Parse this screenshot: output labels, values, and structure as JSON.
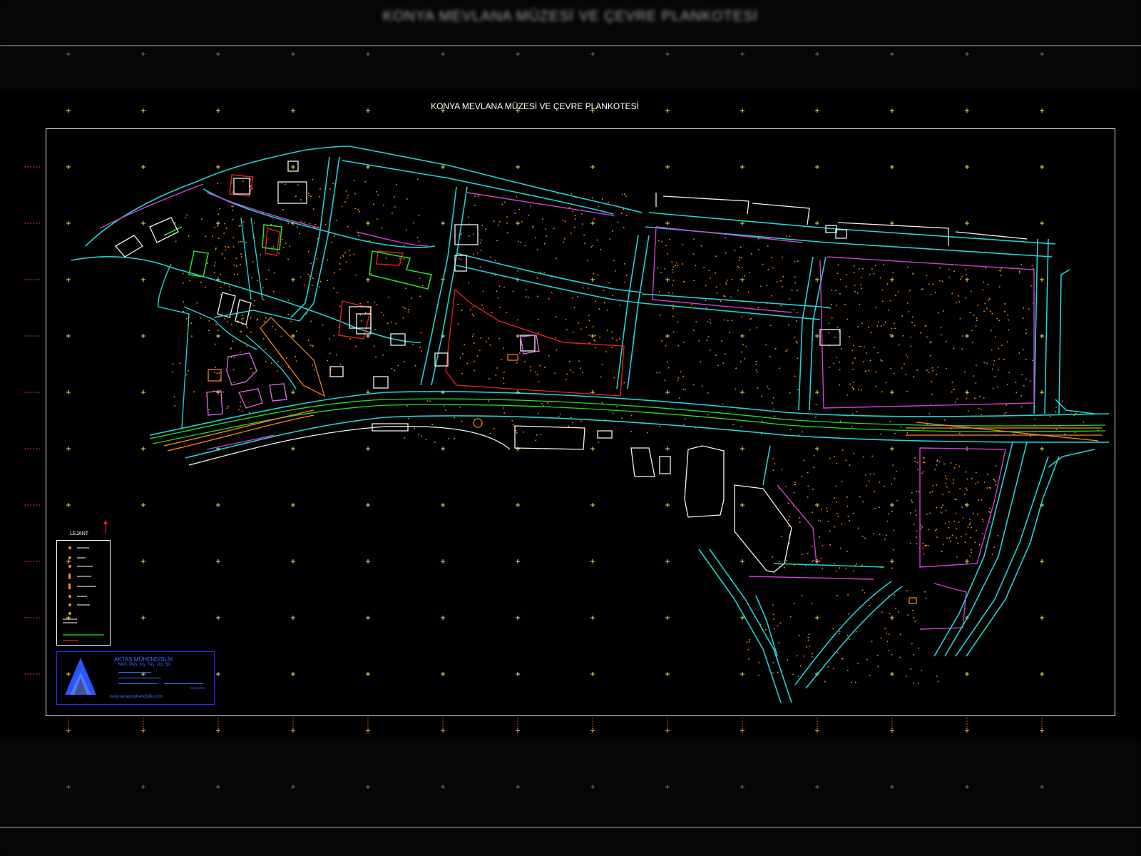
{
  "header": {
    "blurred_title": "KONYA MEVLANA MÜZESİ VE ÇEVRE PLANKOTESİ"
  },
  "map": {
    "title": "KONYA MEVLANA MÜZESİ VE ÇEVRE PLANKOTESİ",
    "legend_title": "LEJANT",
    "colors": {
      "road": "#22d3d3",
      "parcel": "#d040d0",
      "building": "#f2f2f2",
      "wall_red": "#e02020",
      "green": "#22dd22",
      "points": "#ff8a1e",
      "grid_cross": "#e8e860",
      "title_block": "#2a2aff",
      "coordinates": "#ff3030"
    }
  },
  "title_block": {
    "company": "AKTAŞ MÜHENDİSLİK",
    "subtitle": "Müh. Müş. İnş. Taş. Ltd. Şti.",
    "website": "www.aktasmuhendislik.com"
  }
}
